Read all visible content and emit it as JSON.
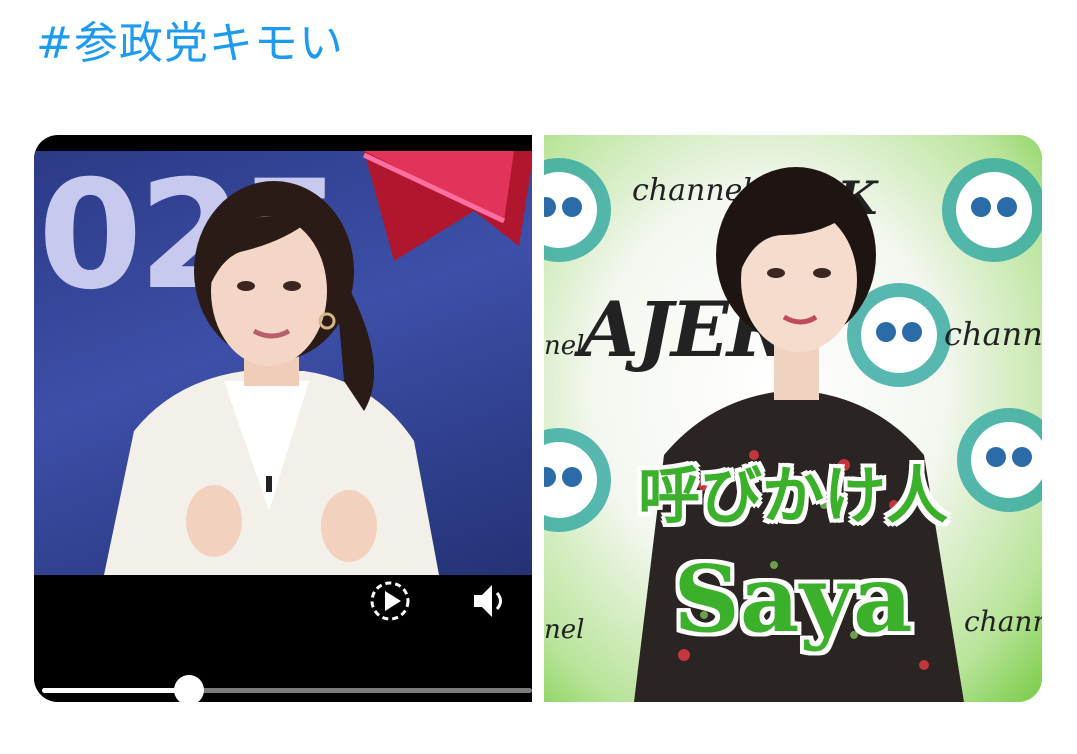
{
  "post": {
    "hashtag": "#参政党キモい",
    "hashtag_color": "#1d9bf0"
  },
  "video": {
    "background_digits": "025",
    "progress_fraction": 0.3,
    "controls": [
      "replay-icon",
      "volume-icon"
    ]
  },
  "photo": {
    "logo_channel": "channel",
    "logo_sk": "SK",
    "logo_ajer": "AJER",
    "logo_nel": "nel",
    "caption_line1": "呼びかけ人",
    "caption_line2": "Saya",
    "caption_color": "#3bb02a"
  }
}
